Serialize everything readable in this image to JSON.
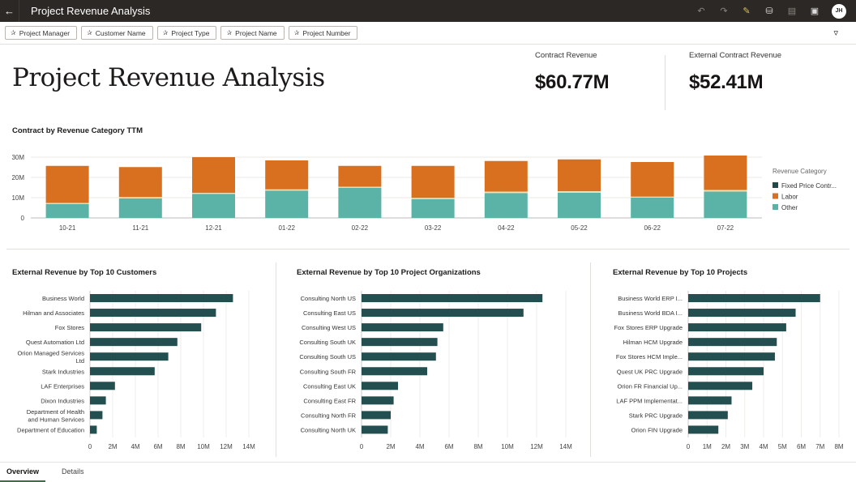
{
  "header": {
    "title": "Project Revenue Analysis",
    "avatar_initials": "JH",
    "icons": [
      "undo-icon",
      "redo-icon",
      "edit-icon",
      "data-icon",
      "comment-icon",
      "present-icon"
    ]
  },
  "filters": [
    "Project Manager",
    "Customer Name",
    "Project Type",
    "Project Name",
    "Project Number"
  ],
  "page_title": "Project Revenue Analysis",
  "kpis": [
    {
      "label": "Contract Revenue",
      "value": "$60.77M"
    },
    {
      "label": "External Contract Revenue",
      "value": "$52.41M"
    }
  ],
  "tabs": [
    {
      "label": "Overview",
      "active": true
    },
    {
      "label": "Details",
      "active": false
    }
  ],
  "chart_data": [
    {
      "type": "bar",
      "stacked": true,
      "title": "Contract by Revenue Category TTM",
      "categories": [
        "10-21",
        "11-21",
        "12-21",
        "01-22",
        "02-22",
        "03-22",
        "04-22",
        "05-22",
        "06-22",
        "07-22"
      ],
      "ylim": [
        0,
        30
      ],
      "yticks": [
        "0",
        "10M",
        "20M",
        "30M"
      ],
      "ytick_values": [
        0,
        10,
        20,
        30
      ],
      "unit": "M",
      "legend_title": "Revenue Category",
      "legend_position": "right",
      "grid": true,
      "series": [
        {
          "name": "Other",
          "color": "#5bb2a6",
          "values": [
            6.9,
            9.6,
            11.9,
            13.5,
            14.9,
            9.3,
            12.3,
            12.4,
            10.0,
            13.0
          ]
        },
        {
          "name": "Fixed Price Contr...",
          "color": "#1f4a4a",
          "segment_color": "#ece0b4",
          "values": [
            0.5,
            0.7,
            0.5,
            0.6,
            0.5,
            0.6,
            0.7,
            0.8,
            0.5,
            0.8
          ]
        },
        {
          "name": "Labor",
          "color": "#d9701f",
          "values": [
            18.3,
            14.8,
            17.6,
            14.3,
            10.3,
            15.8,
            15.1,
            15.7,
            17.1,
            17.0
          ]
        }
      ],
      "legend_order": [
        "Fixed Price Contr...",
        "Labor",
        "Other"
      ]
    },
    {
      "type": "bar",
      "orientation": "horizontal",
      "title": "External Revenue by Top 10 Customers",
      "categories": [
        "Business World",
        "Hilman and Associates",
        "Fox Stores",
        "Quest Automation Ltd",
        "Orion Managed Services Ltd",
        "Stark Industries",
        "LAF Enterprises",
        "Dixon Industries",
        "Department of Health and Human Services",
        "Department of Education"
      ],
      "values": [
        12.6,
        11.1,
        9.8,
        7.7,
        6.9,
        5.7,
        2.2,
        1.4,
        1.1,
        0.6
      ],
      "xlim": [
        0,
        14
      ],
      "xticks": [
        "0",
        "2M",
        "4M",
        "6M",
        "8M",
        "10M",
        "12M",
        "14M"
      ],
      "xtick_values": [
        0,
        2,
        4,
        6,
        8,
        10,
        12,
        14
      ],
      "color": "#234f50"
    },
    {
      "type": "bar",
      "orientation": "horizontal",
      "title": "External Revenue by Top 10 Project Organizations",
      "categories": [
        "Consulting North US",
        "Consulting East US",
        "Consulting West US",
        "Consulting South UK",
        "Consulting South US",
        "Consulting South FR",
        "Consulting East UK",
        "Consulting East FR",
        "Consulting North FR",
        "Consulting North UK"
      ],
      "values": [
        12.4,
        11.1,
        5.6,
        5.2,
        5.1,
        4.5,
        2.5,
        2.2,
        2.0,
        1.8
      ],
      "xlim": [
        0,
        14
      ],
      "xticks": [
        "0",
        "2M",
        "4M",
        "6M",
        "8M",
        "10M",
        "12M",
        "14M"
      ],
      "xtick_values": [
        0,
        2,
        4,
        6,
        8,
        10,
        12,
        14
      ],
      "color": "#234f50"
    },
    {
      "type": "bar",
      "orientation": "horizontal",
      "title": "External Revenue by Top 10 Projects",
      "categories": [
        "Business World ERP I...",
        "Business World BDA I...",
        "Fox Stores ERP Upgrade",
        "Hilman HCM Upgrade",
        "Fox Stores HCM Imple...",
        "Quest UK PRC Upgrade",
        "Orion FR Financial Up...",
        "LAF PPM Implementat...",
        "Stark PRC Upgrade",
        "Orion FIN Upgrade"
      ],
      "values": [
        7.0,
        5.7,
        5.2,
        4.7,
        4.6,
        4.0,
        3.4,
        2.3,
        2.1,
        1.6
      ],
      "xlim": [
        0,
        8
      ],
      "xticks": [
        "0",
        "1M",
        "2M",
        "3M",
        "4M",
        "5M",
        "6M",
        "7M",
        "8M"
      ],
      "xtick_values": [
        0,
        1,
        2,
        3,
        4,
        5,
        6,
        7,
        8
      ],
      "color": "#234f50"
    }
  ]
}
